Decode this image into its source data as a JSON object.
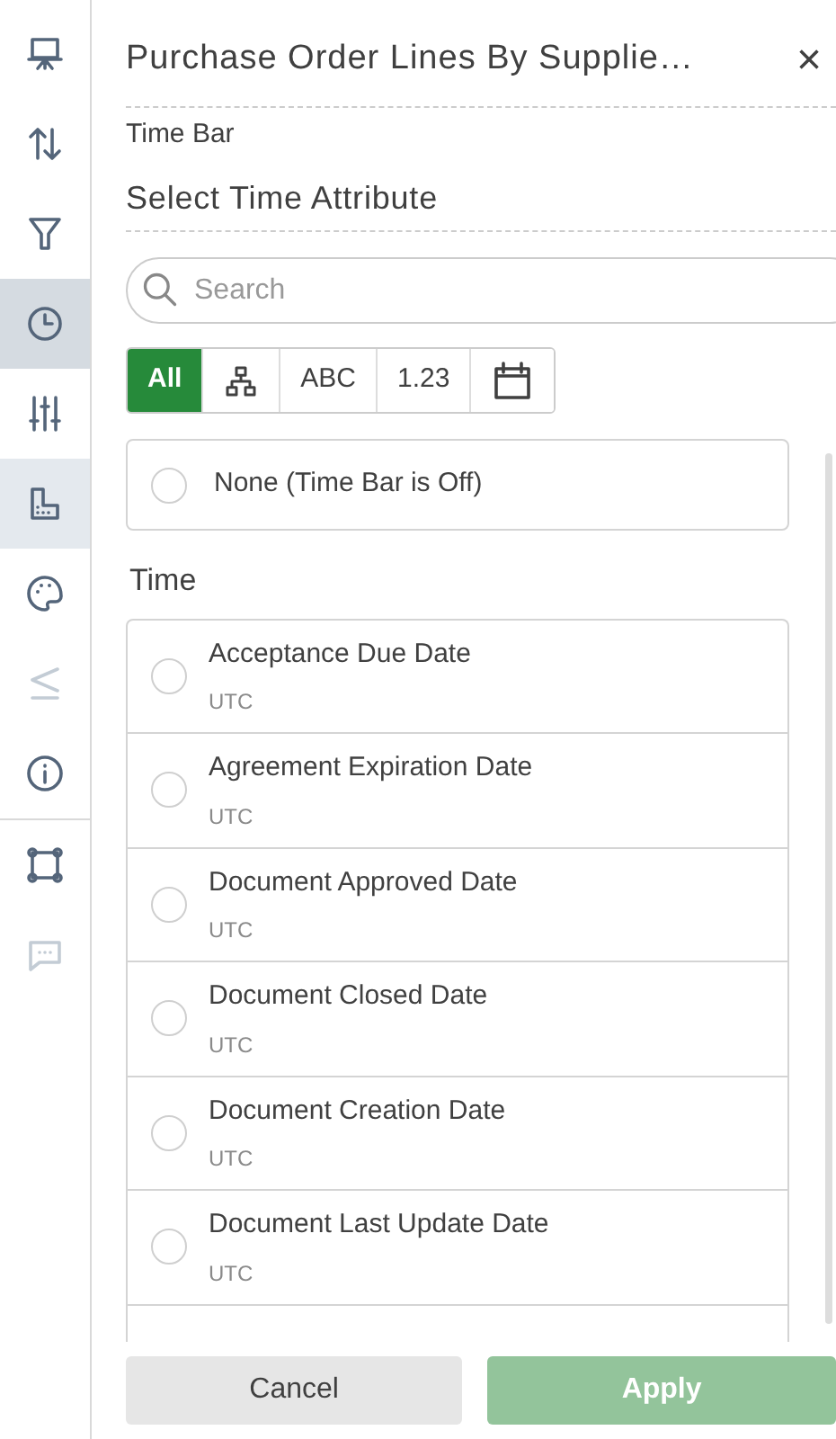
{
  "sidebar": {
    "items": [
      {
        "selected": false,
        "highlighted": false,
        "disabled": false
      },
      {
        "selected": false,
        "highlighted": false,
        "disabled": false
      },
      {
        "selected": false,
        "highlighted": false,
        "disabled": false
      },
      {
        "selected": true,
        "highlighted": false,
        "disabled": false
      },
      {
        "selected": false,
        "highlighted": false,
        "disabled": false
      },
      {
        "selected": false,
        "highlighted": true,
        "disabled": false
      },
      {
        "selected": false,
        "highlighted": false,
        "disabled": false
      },
      {
        "selected": false,
        "highlighted": false,
        "disabled": true
      },
      {
        "selected": false,
        "highlighted": false,
        "disabled": false
      },
      {
        "selected": false,
        "highlighted": false,
        "disabled": false
      },
      {
        "selected": false,
        "highlighted": false,
        "disabled": true
      }
    ]
  },
  "panel": {
    "title": "Purchase Order Lines By Supplie…",
    "close": "×",
    "subtitle": "Time Bar",
    "heading": "Select Time Attribute",
    "search": {
      "placeholder": "Search"
    },
    "filters": [
      {
        "kind": "text",
        "label": "All",
        "selected": true
      },
      {
        "kind": "hierarchy",
        "selected": false
      },
      {
        "kind": "text",
        "label": "ABC",
        "selected": false
      },
      {
        "kind": "text",
        "label": "1.23",
        "selected": false
      },
      {
        "kind": "calendar",
        "selected": false
      }
    ],
    "none_option": {
      "label": "None (Time Bar is Off)",
      "selected": false
    },
    "group_label": "Time",
    "options": [
      {
        "label": "Acceptance Due Date",
        "sub": "UTC",
        "selected": false
      },
      {
        "label": "Agreement Expiration Date",
        "sub": "UTC",
        "selected": false
      },
      {
        "label": "Document Approved Date",
        "sub": "UTC",
        "selected": false
      },
      {
        "label": "Document Closed Date",
        "sub": "UTC",
        "selected": false
      },
      {
        "label": "Document Creation Date",
        "sub": "UTC",
        "selected": false
      },
      {
        "label": "Document Last Update Date",
        "sub": "UTC",
        "selected": false
      }
    ],
    "buttons": [
      {
        "kind": "secondary",
        "label": "Cancel",
        "disabled": false
      },
      {
        "kind": "primary",
        "label": "Apply",
        "disabled": true
      }
    ]
  }
}
